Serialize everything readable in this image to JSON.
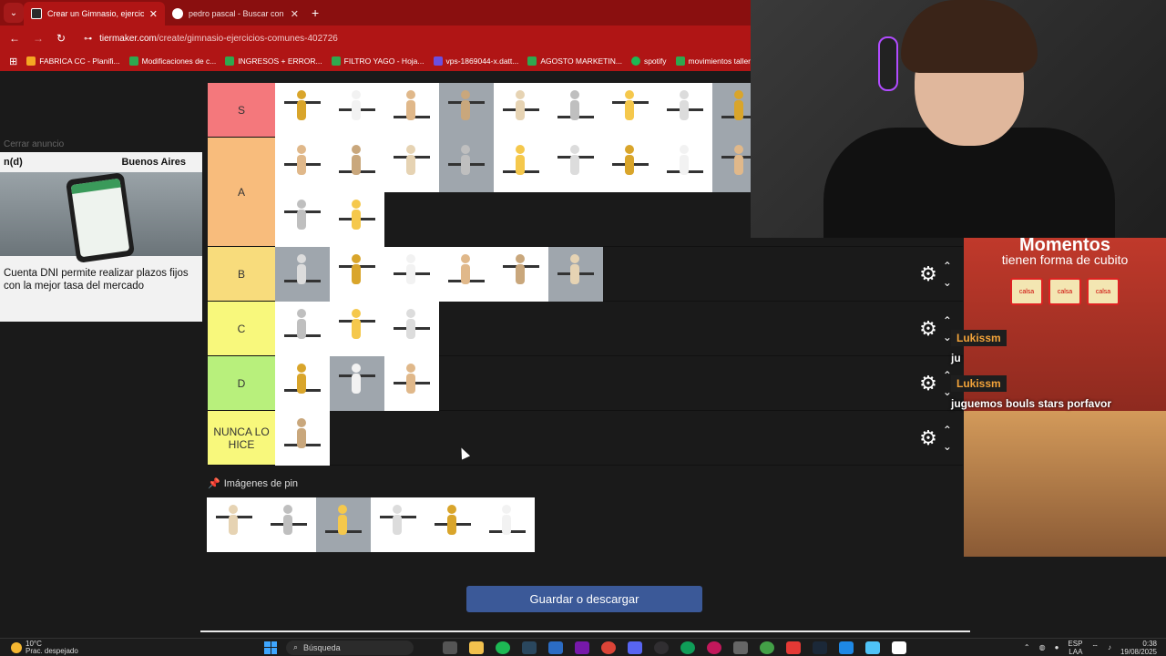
{
  "browser": {
    "tabs": [
      {
        "title": "Crear un Gimnasio, ejercicios co",
        "active": true,
        "favicon_color": "#2b2b2b"
      },
      {
        "title": "pedro pascal - Buscar con Goog",
        "active": false,
        "favicon_color": "#4285f4"
      }
    ],
    "url_host": "tiermaker.com",
    "url_path": "/create/gimnasio-ejercicios-comunes-402726",
    "bookmarks": [
      "FABRICA CC - Planifi...",
      "Modificaciones de c...",
      "INGRESOS + ERROR...",
      "FILTRO YAGO - Hoja...",
      "vps-1869044-x.datt...",
      "AGOSTO MARKETIN...",
      "spotify",
      "movimientos tallere..."
    ]
  },
  "ad": {
    "close_label": "Cerrar anuncio",
    "brand_left": "n(d)",
    "brand_right": "Buenos Aires",
    "headline": "Cuenta DNI permite realizar plazos fijos con la mejor tasa del mercado"
  },
  "tiers": [
    {
      "label": "S",
      "color": "#f4787c",
      "count": 10,
      "rows": 1
    },
    {
      "label": "A",
      "color": "#f8bc7c",
      "count": 13,
      "rows": 2
    },
    {
      "label": "B",
      "color": "#f8dc7c",
      "count": 6,
      "rows": 1
    },
    {
      "label": "C",
      "color": "#f8f87c",
      "count": 3,
      "rows": 1
    },
    {
      "label": "D",
      "color": "#b8f07c",
      "count": 3,
      "rows": 1
    },
    {
      "label": "NUNCA LO HICE",
      "color": "#f8f87c",
      "count": 1,
      "rows": 1
    }
  ],
  "pinned": {
    "title": "Imágenes de pin",
    "count": 6
  },
  "save_button": "Guardar o descargar",
  "stream": {
    "promo_line1": "Momentos",
    "promo_line2": "tienen forma de cubito",
    "promo_pkg": "calsa",
    "chat": [
      {
        "user": "Lukissm",
        "message": "ju"
      },
      {
        "user": "Lukissm",
        "message": "juguemos bouls stars porfavor"
      }
    ]
  },
  "taskbar": {
    "temperature": "10°C",
    "weather": "Prac. despejado",
    "search_placeholder": "Búsqueda",
    "lang_top": "ESP",
    "lang_bottom": "LAA",
    "time": "0:38",
    "date": "19/08/2025"
  }
}
